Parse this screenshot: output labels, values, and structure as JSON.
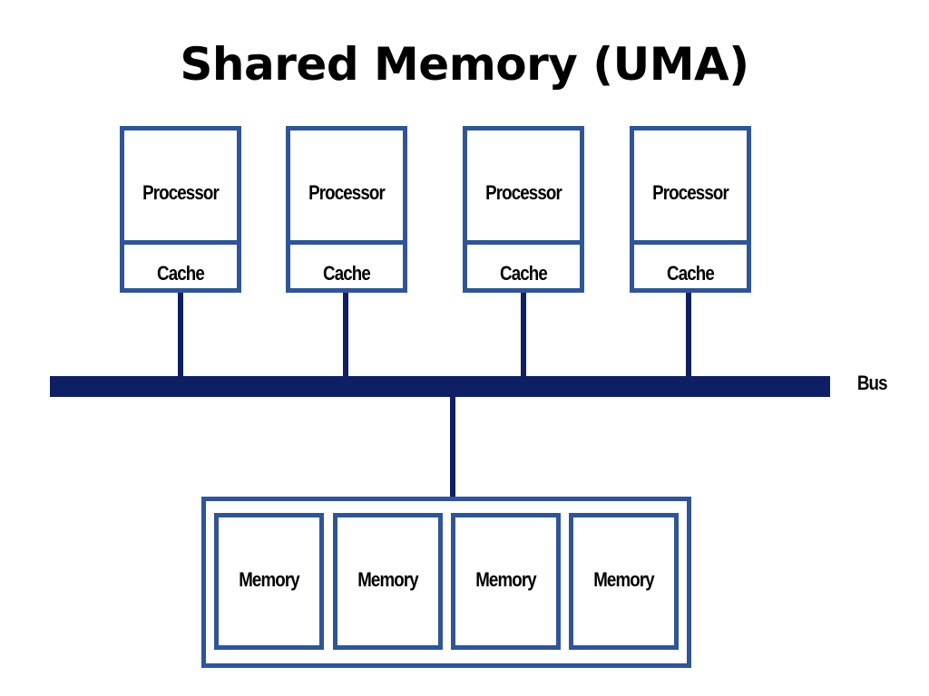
{
  "title": "Shared Memory (UMA)",
  "processors": [
    {
      "label": "Processor",
      "cache_label": "Cache"
    },
    {
      "label": "Processor",
      "cache_label": "Cache"
    },
    {
      "label": "Processor",
      "cache_label": "Cache"
    },
    {
      "label": "Processor",
      "cache_label": "Cache"
    }
  ],
  "bus": {
    "label": "Bus"
  },
  "memory_modules": [
    {
      "label": "Memory"
    },
    {
      "label": "Memory"
    },
    {
      "label": "Memory"
    },
    {
      "label": "Memory"
    }
  ],
  "colors": {
    "box_border": "#2f5597",
    "bus": "#0f1f63"
  }
}
